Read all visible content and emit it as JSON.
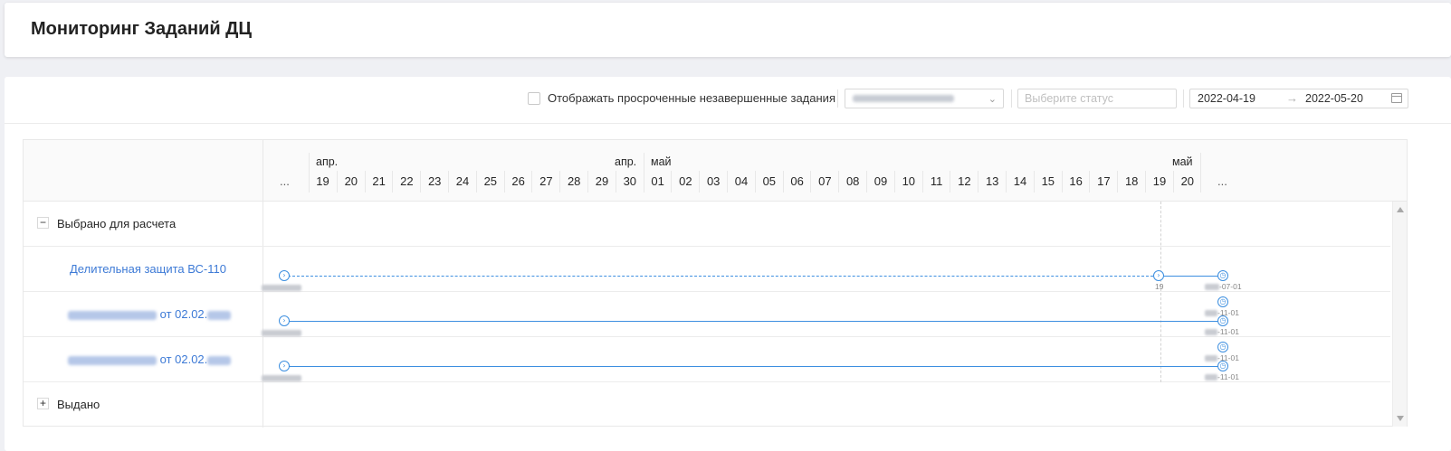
{
  "header": {
    "title": "Мониторинг Заданий ДЦ"
  },
  "filters": {
    "overdue_checkbox_label": "Отображать просроченные незавершенные задания",
    "status_placeholder": "Выберите статус",
    "date_from": "2022-04-19",
    "date_arrow": "→",
    "date_to": "2022-05-20"
  },
  "timeline": {
    "ellipsis": "...",
    "months": [
      "апр.",
      "апр.",
      "май",
      "май"
    ],
    "days": [
      "19",
      "20",
      "21",
      "22",
      "23",
      "24",
      "25",
      "26",
      "27",
      "28",
      "29",
      "30",
      "01",
      "02",
      "03",
      "04",
      "05",
      "06",
      "07",
      "08",
      "09",
      "10",
      "11",
      "12",
      "13",
      "14",
      "15",
      "16",
      "17",
      "18",
      "19",
      "20"
    ]
  },
  "groups": [
    {
      "label": "Выбрано для расчета",
      "toggle": "−"
    },
    {
      "label": "Выдано",
      "toggle": "+"
    }
  ],
  "tasks": [
    {
      "name": "Делительная защита ВС-110",
      "milestones": [
        "19",
        "-07-01"
      ]
    },
    {
      "name": "от 02.02.",
      "milestones": [
        "-11-01",
        "-11-01"
      ]
    },
    {
      "name": "от 02.02.",
      "milestones": [
        "-11-01",
        "-11-01"
      ]
    }
  ],
  "colors": {
    "accent": "#3d8fe0",
    "link": "#3d7ad6"
  },
  "icons": {
    "milestone_start": "chevron-right-circle-icon",
    "milestone_end": "clock-circle-icon"
  }
}
